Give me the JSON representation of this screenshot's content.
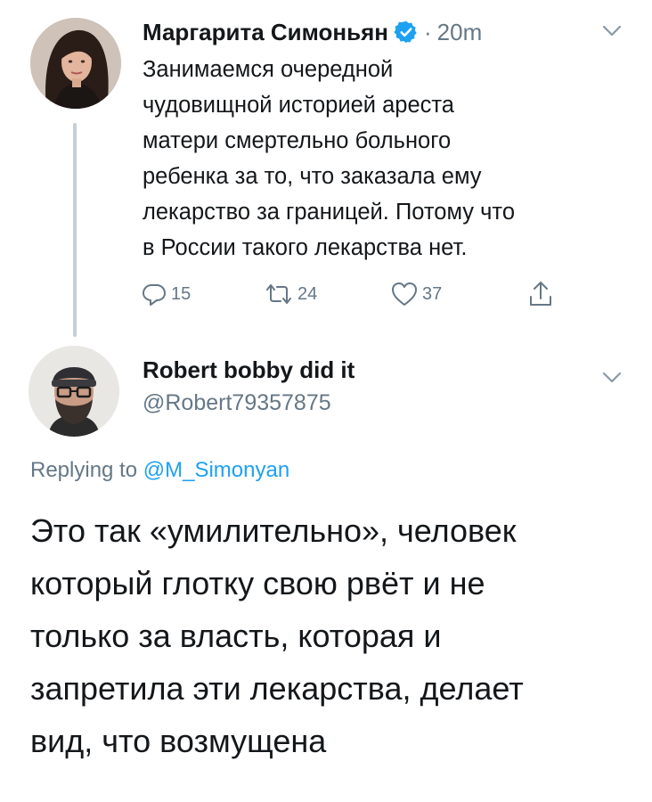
{
  "tweet": {
    "author_name": "Маргарита Симоньян",
    "separator": "·",
    "time": "20m",
    "text_lines": [
      "Занимаемся очередной",
      "чудовищной историей ареста",
      "матери смертельно больного",
      "ребенка за то, что заказала ему",
      "лекарство за границей. Потому что",
      "в России такого лекарства нет."
    ],
    "actions": {
      "replies": "15",
      "retweets": "24",
      "likes": "37"
    }
  },
  "reply": {
    "author_name": "Robert bobby did it",
    "handle": "@Robert79357875",
    "replying_to_label": "Replying to",
    "replying_to_mention": "@M_Simonyan",
    "text_lines": [
      "Это так «умилительно», человек",
      "который глотку свою рвёт и не",
      "только за власть, которая и",
      "запретила эти лекарства, делает",
      "вид, что возмущена"
    ]
  },
  "icons": {
    "verified": "verified-badge-icon",
    "caret": "chevron-down-icon",
    "reply": "reply-icon",
    "retweet": "retweet-icon",
    "like": "heart-icon",
    "share": "share-icon"
  },
  "colors": {
    "text": "#14171a",
    "secondary": "#657786",
    "accent": "#1da1f2",
    "thread_line": "#c4cfd6"
  }
}
